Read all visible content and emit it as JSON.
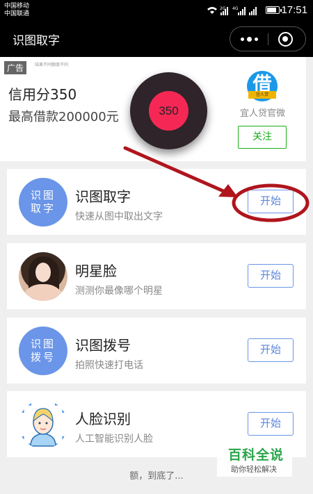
{
  "statusbar": {
    "carrier_1": "中国移动",
    "carrier_2": "中国联通",
    "network_1": "2G",
    "network_2": "4G",
    "time": "17:51"
  },
  "nav": {
    "title": "识图取字"
  },
  "ad": {
    "tag": "广告",
    "small_print": "结果不同额度不同",
    "title": "信用分350",
    "subtitle": "最高借款200000元",
    "logo_char": "借",
    "logo_band": "宜人贷",
    "brand": "宜人贷官微",
    "follow_label": "关注",
    "badge_value": "350"
  },
  "cards": [
    {
      "avatar_line1": "识图",
      "avatar_line2": "取字",
      "title": "识图取字",
      "desc": "快速从图中取出文字",
      "button": "开始"
    },
    {
      "title": "明星脸",
      "desc": "测测你最像哪个明星",
      "button": "开始"
    },
    {
      "avatar_line1": "识图",
      "avatar_line2": "拨号",
      "title": "识图拨号",
      "desc": "拍照快速打电话",
      "button": "开始"
    },
    {
      "title": "人脸识别",
      "desc": "人工智能识别人脸",
      "button": "开始"
    }
  ],
  "footer": {
    "text": "额，到底了..."
  },
  "watermark": {
    "main": "百科全说",
    "sub": "助你轻松解决"
  },
  "colors": {
    "accent_blue": "#6a95e8",
    "wechat_green": "#1aad19",
    "annotation_red": "#b0151d",
    "badge_red": "#f52855"
  }
}
